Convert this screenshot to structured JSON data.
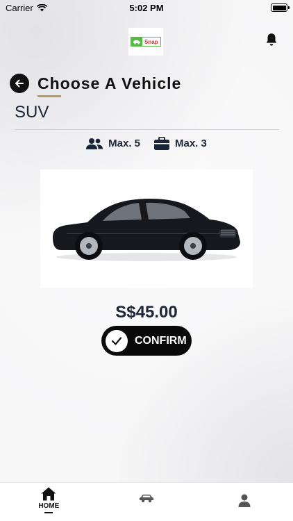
{
  "status_bar": {
    "carrier": "Carrier",
    "time": "5:02 PM"
  },
  "header": {
    "logo_text": "Snap"
  },
  "page": {
    "title": "Choose A Vehicle"
  },
  "vehicle": {
    "type": "SUV",
    "max_passengers": "Max. 5",
    "max_luggage": "Max. 3",
    "price": "S$45.00"
  },
  "actions": {
    "confirm_label": "CONFIRM"
  },
  "tab_bar": {
    "home_label": "HOME",
    "active_tab": "home"
  },
  "colors": {
    "accent_underline": "#b79a63",
    "button_bg": "#0a0a0a",
    "text_dark": "#1a2536",
    "logo_green": "#58b947",
    "logo_red": "#d92f2f"
  }
}
